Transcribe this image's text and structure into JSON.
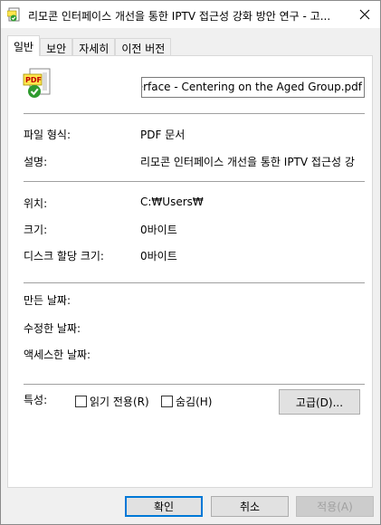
{
  "window": {
    "title": "리모콘 인터페이스 개선을 통한 IPTV 접근성 강화 방안 연구 - 고..."
  },
  "tabs": [
    {
      "label": "일반"
    },
    {
      "label": "보안"
    },
    {
      "label": "자세히"
    },
    {
      "label": "이전 버전"
    }
  ],
  "general": {
    "filename": "nterface - Centering on the Aged Group.pdf",
    "file_icon": "pdf-file-icon",
    "rows": {
      "file_type": {
        "label": "파일 형식:",
        "value": "PDF 문서"
      },
      "description": {
        "label": "설명:",
        "value": "리모콘 인터페이스 개선을 통한 IPTV 접근성 강"
      },
      "location": {
        "label": "위치:",
        "value": "C:₩Users₩"
      },
      "size": {
        "label": "크기:",
        "value": "0바이트"
      },
      "size_on_disk": {
        "label": "디스크 할당 크기:",
        "value": "0바이트"
      },
      "created": {
        "label": "만든 날짜:",
        "value": ""
      },
      "modified": {
        "label": "수정한 날짜:",
        "value": ""
      },
      "accessed": {
        "label": "액세스한 날짜:",
        "value": ""
      }
    },
    "attributes": {
      "label": "특성:",
      "readonly": {
        "label": "읽기 전용(R)",
        "checked": false
      },
      "hidden": {
        "label": "숨김(H)",
        "checked": false
      },
      "advanced_button": "고급(D)..."
    }
  },
  "footer": {
    "ok": "확인",
    "cancel": "취소",
    "apply": "적용(A)"
  },
  "colors": {
    "accent": "#0078d7",
    "pdf_icon": "#1e7d22"
  }
}
